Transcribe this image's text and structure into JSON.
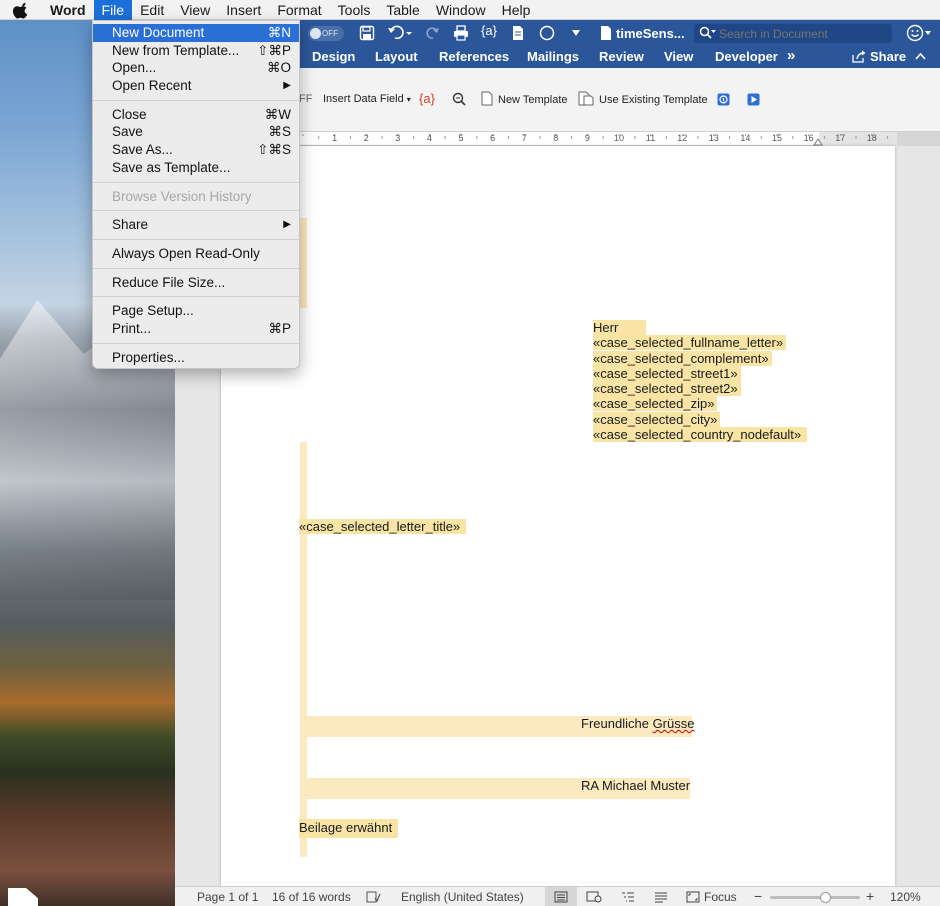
{
  "menubar": {
    "app_name": "Word",
    "items": [
      "File",
      "Edit",
      "View",
      "Insert",
      "Format",
      "Tools",
      "Table",
      "Window",
      "Help"
    ]
  },
  "titlebar": {
    "toggle_label": "OFF",
    "doc_title": "timeSens...",
    "search_placeholder": "Search in Document"
  },
  "ribbon_tabs": {
    "items": [
      "Design",
      "Layout",
      "References",
      "Mailings",
      "Review",
      "View",
      "Developer"
    ],
    "more": "»",
    "share": "Share"
  },
  "ribbon": {
    "truncated": "FF",
    "insert_data_field": "Insert Data Field",
    "new_template": "New Template",
    "use_existing_template": "Use Existing Template"
  },
  "ruler": {
    "ticks": [
      "1",
      "2",
      "3",
      "4",
      "5",
      "6",
      "7",
      "8",
      "9",
      "10",
      "11",
      "12",
      "13",
      "14",
      "15",
      "16",
      "17",
      "18"
    ]
  },
  "file_menu": {
    "groups": [
      [
        {
          "label": "New Document",
          "shortcut": "⌘N",
          "highlighted": true
        },
        {
          "label": "New from Template...",
          "shortcut": "⇧⌘P"
        },
        {
          "label": "Open...",
          "shortcut": "⌘O"
        },
        {
          "label": "Open Recent",
          "shortcut": "▶"
        }
      ],
      [
        {
          "label": "Close",
          "shortcut": "⌘W"
        },
        {
          "label": "Save",
          "shortcut": "⌘S"
        },
        {
          "label": "Save As...",
          "shortcut": "⇧⌘S"
        },
        {
          "label": "Save as Template...",
          "shortcut": ""
        }
      ],
      [
        {
          "label": "Browse Version History",
          "shortcut": "",
          "disabled": true
        }
      ],
      [
        {
          "label": "Share",
          "shortcut": "▶"
        }
      ],
      [
        {
          "label": "Always Open Read-Only",
          "shortcut": ""
        }
      ],
      [
        {
          "label": "Reduce File Size...",
          "shortcut": ""
        }
      ],
      [
        {
          "label": "Page Setup...",
          "shortcut": ""
        },
        {
          "label": "Print...",
          "shortcut": "⌘P"
        }
      ],
      [
        {
          "label": "Properties...",
          "shortcut": ""
        }
      ]
    ]
  },
  "document": {
    "address_lines": [
      "Herr",
      "«case_selected_fullname_letter»",
      "«case_selected_complement»",
      "«case_selected_street1»",
      "«case_selected_street2»",
      "«case_selected_zip»",
      "«case_selected_city»",
      "«case_selected_country_nodefault»"
    ],
    "letter_title": "«case_selected_letter_title»",
    "closing_word": "Freundliche",
    "closing_greeting": "Grüsse",
    "signature": "RA Michael Muster",
    "enclosure": "Beilage erwähnt"
  },
  "statusbar": {
    "page": "Page 1 of 1",
    "words": "16 of 16 words",
    "language": "English (United States)",
    "focus": "Focus",
    "zoom": "120%",
    "zoom_level_fraction": 0.62
  }
}
